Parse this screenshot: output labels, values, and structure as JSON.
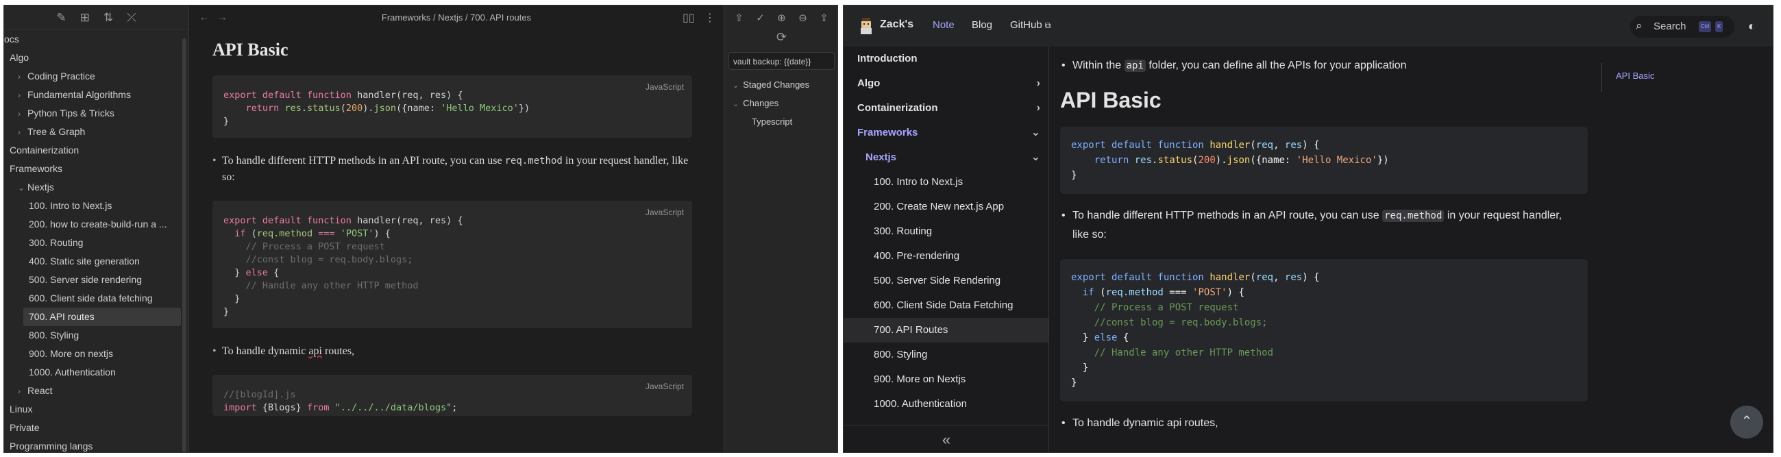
{
  "obsidian": {
    "tree": [
      {
        "label": "ocs",
        "indent": 0,
        "chev": ""
      },
      {
        "label": "Algo",
        "indent": 1,
        "chev": ""
      },
      {
        "label": "Coding Practice",
        "indent": 2,
        "chev": "›"
      },
      {
        "label": "Fundamental Algorithms",
        "indent": 2,
        "chev": "›"
      },
      {
        "label": "Python Tips & Tricks",
        "indent": 2,
        "chev": "›"
      },
      {
        "label": "Tree & Graph",
        "indent": 2,
        "chev": "›"
      },
      {
        "label": "Containerization",
        "indent": 1,
        "chev": ""
      },
      {
        "label": "Frameworks",
        "indent": 1,
        "chev": ""
      },
      {
        "label": "Nextjs",
        "indent": 2,
        "chev": "⌄"
      },
      {
        "label": "100. Intro to Next.js",
        "indent": 3,
        "chev": ""
      },
      {
        "label": "200. how to create-build-run a ...",
        "indent": 3,
        "chev": ""
      },
      {
        "label": "300. Routing",
        "indent": 3,
        "chev": ""
      },
      {
        "label": "400. Static site generation",
        "indent": 3,
        "chev": ""
      },
      {
        "label": "500. Server side rendering",
        "indent": 3,
        "chev": ""
      },
      {
        "label": "600. Client side data fetching",
        "indent": 3,
        "chev": ""
      },
      {
        "label": "700. API routes",
        "indent": 3,
        "chev": "",
        "active": true
      },
      {
        "label": "800. Styling",
        "indent": 3,
        "chev": ""
      },
      {
        "label": "900. More on nextjs",
        "indent": 3,
        "chev": ""
      },
      {
        "label": "1000. Authentication",
        "indent": 3,
        "chev": ""
      },
      {
        "label": "React",
        "indent": 2,
        "chev": "›"
      },
      {
        "label": "Linux",
        "indent": 1,
        "chev": ""
      },
      {
        "label": "Private",
        "indent": 1,
        "chev": ""
      },
      {
        "label": "Programming langs",
        "indent": 1,
        "chev": ""
      }
    ],
    "breadcrumb": "Frameworks / Nextjs / 700. API routes",
    "title": "API Basic",
    "lang_label": "JavaScript",
    "para1_a": "To handle different HTTP methods in an API route, you can use ",
    "para1_code": "req.method",
    "para1_b": " in your request handler, like so:",
    "para2_a": "To handle dynamic ",
    "para2_mis": "api",
    "para2_b": " routes,",
    "git_input": "vault backup: {{date}}",
    "git_staged": "Staged Changes",
    "git_changes": "Changes",
    "git_file": "Typescript"
  },
  "docs": {
    "brand": "Zack's",
    "nav_note": "Note",
    "nav_blog": "Blog",
    "nav_github": "GitHub",
    "search_label": "Search",
    "kbd_ctrl": "Ctrl",
    "kbd_k": "K",
    "sidebar": [
      {
        "label": "Introduction",
        "type": "top"
      },
      {
        "label": "Algo",
        "type": "top",
        "caret": "›"
      },
      {
        "label": "Containerization",
        "type": "top",
        "caret": "›"
      },
      {
        "label": "Frameworks",
        "type": "topcat",
        "caret": "⌄"
      },
      {
        "label": "Nextjs",
        "type": "subcat",
        "caret": "⌄"
      },
      {
        "label": "100. Intro to Next.js",
        "type": "leaf"
      },
      {
        "label": "200. Create New next.js App",
        "type": "leaf"
      },
      {
        "label": "300. Routing",
        "type": "leaf"
      },
      {
        "label": "400. Pre-rendering",
        "type": "leaf"
      },
      {
        "label": "500. Server Side Rendering",
        "type": "leaf"
      },
      {
        "label": "600. Client Side Data Fetching",
        "type": "leaf"
      },
      {
        "label": "700. API Routes",
        "type": "leaf",
        "active": true
      },
      {
        "label": "800. Styling",
        "type": "leaf"
      },
      {
        "label": "900. More on Nextjs",
        "type": "leaf"
      },
      {
        "label": "1000. Authentication",
        "type": "leaf"
      }
    ],
    "intro_a": "Within the ",
    "intro_code": "api",
    "intro_b": " folder, you can define all the APIs for your application",
    "title": "API Basic",
    "para1_a": "To handle different HTTP methods in an API route, you can use ",
    "para1_code": "req.method",
    "para1_b": " in your request handler, like so:",
    "para2": "To handle dynamic api routes,",
    "toc_item": "API Basic"
  }
}
